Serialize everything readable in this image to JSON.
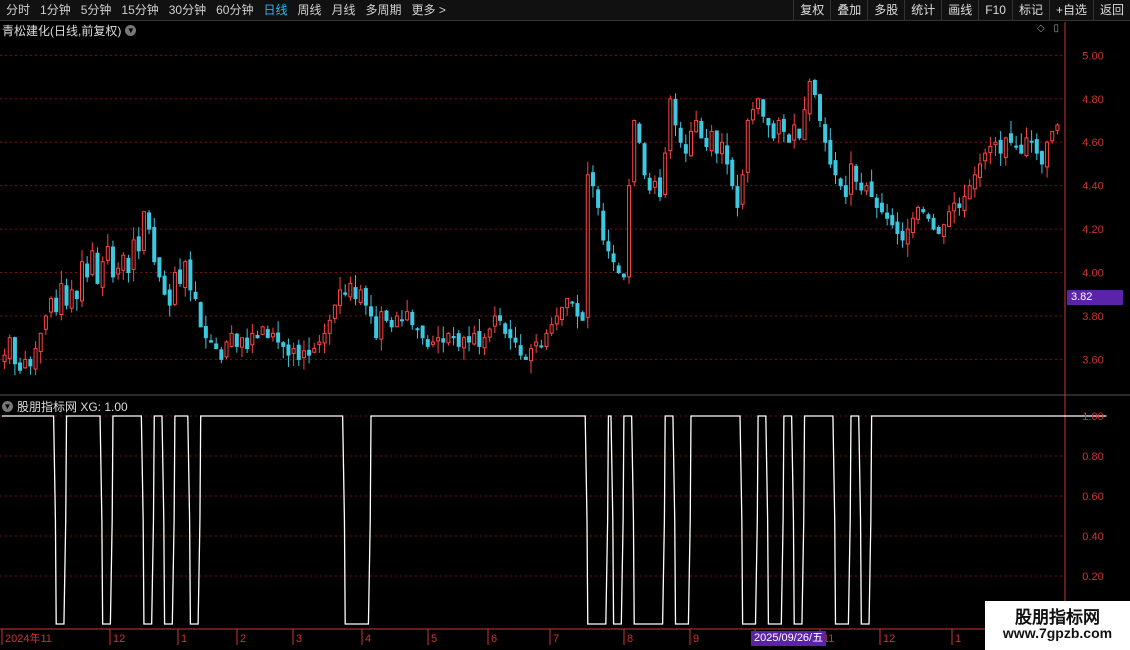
{
  "toolbar": {
    "periods": [
      "分时",
      "1分钟",
      "5分钟",
      "15分钟",
      "30分钟",
      "60分钟",
      "日线",
      "周线",
      "月线",
      "多周期",
      "更多 >"
    ],
    "active_period": "日线",
    "right_buttons": [
      "复权",
      "叠加",
      "多股",
      "统计",
      "画线",
      "F10",
      "标记",
      "+自选",
      "返回"
    ]
  },
  "main_chart": {
    "title": "青松建化(日线,前复权)",
    "current_price": "3.82",
    "y_ticks": [
      "5.00",
      "4.80",
      "4.60",
      "4.40",
      "4.20",
      "4.00",
      "3.80",
      "3.60"
    ]
  },
  "indicator": {
    "title": "股朋指标网 XG: 1.00",
    "y_ticks": [
      "1.00",
      "0.80",
      "0.60",
      "0.40",
      "0.20"
    ]
  },
  "x_axis": {
    "labels": [
      "2024年11",
      "12",
      "1",
      "2",
      "3",
      "4",
      "5",
      "6",
      "7",
      "8",
      "9",
      "10",
      "11",
      "12",
      "1"
    ],
    "cursor_date": "2025/09/26/五"
  },
  "watermark": {
    "title": "股朋指标网",
    "url": "www.7gpzb.com"
  },
  "colors": {
    "up": "#ff4444",
    "down": "#3cc8e0",
    "grid": "#7a1010",
    "axis": "#c33",
    "signal": "#ffffff"
  },
  "chart_data": {
    "type": "candlestick",
    "y_range": [
      3.45,
      5.08
    ],
    "note": "",
    "closes": [
      3.62,
      3.7,
      3.58,
      3.55,
      3.6,
      3.57,
      3.65,
      3.72,
      3.8,
      3.88,
      3.82,
      3.95,
      3.85,
      3.92,
      3.88,
      4.05,
      3.98,
      4.1,
      3.95,
      4.05,
      4.12,
      3.98,
      4.02,
      4.08,
      4.0,
      4.15,
      4.1,
      4.28,
      4.2,
      4.05,
      3.98,
      3.9,
      3.85,
      4.0,
      3.95,
      4.05,
      3.92,
      3.88,
      3.75,
      3.7,
      3.68,
      3.65,
      3.6,
      3.68,
      3.72,
      3.66,
      3.7,
      3.65,
      3.72,
      3.7,
      3.75,
      3.7,
      3.72,
      3.68,
      3.66,
      3.62,
      3.65,
      3.6,
      3.64,
      3.62,
      3.65,
      3.68,
      3.72,
      3.78,
      3.85,
      3.92,
      3.9,
      3.95,
      3.88,
      3.92,
      3.85,
      3.8,
      3.7,
      3.82,
      3.78,
      3.75,
      3.8,
      3.78,
      3.82,
      3.76,
      3.74,
      3.7,
      3.66,
      3.68,
      3.7,
      3.68,
      3.72,
      3.7,
      3.66,
      3.7,
      3.68,
      3.72,
      3.66,
      3.7,
      3.74,
      3.8,
      3.78,
      3.72,
      3.7,
      3.68,
      3.62,
      3.6,
      3.65,
      3.68,
      3.66,
      3.72,
      3.76,
      3.8,
      3.84,
      3.88,
      3.86,
      3.8,
      3.78,
      4.45,
      4.4,
      4.3,
      4.15,
      4.1,
      4.05,
      4.0,
      3.98,
      4.4,
      4.7,
      4.6,
      4.45,
      4.38,
      4.42,
      4.35,
      4.55,
      4.8,
      4.68,
      4.6,
      4.55,
      4.65,
      4.7,
      4.62,
      4.58,
      4.65,
      4.55,
      4.6,
      4.5,
      4.4,
      4.3,
      4.45,
      4.7,
      4.75,
      4.8,
      4.72,
      4.68,
      4.62,
      4.7,
      4.65,
      4.6,
      4.68,
      4.62,
      4.75,
      4.88,
      4.82,
      4.7,
      4.6,
      4.5,
      4.45,
      4.4,
      4.35,
      4.5,
      4.42,
      4.38,
      4.4,
      4.35,
      4.3,
      4.28,
      4.25,
      4.22,
      4.18,
      4.15,
      4.2,
      4.25,
      4.3,
      4.28,
      4.25,
      4.2,
      4.18,
      4.22,
      4.28,
      4.32,
      4.3,
      4.35,
      4.4,
      4.45,
      4.5,
      4.55,
      4.58,
      4.6,
      4.55,
      4.62,
      4.6,
      4.58,
      4.55,
      4.62,
      4.6,
      4.55,
      4.5,
      4.6,
      4.65,
      4.68
    ],
    "signal": [
      1,
      1,
      1,
      1,
      1,
      1,
      1,
      1,
      1,
      1,
      0,
      0,
      1,
      1,
      1,
      1,
      1,
      1,
      1,
      0,
      0,
      1,
      1,
      1,
      1,
      1,
      1,
      0,
      0,
      1,
      1,
      0,
      0,
      1,
      1,
      1,
      0,
      0,
      1,
      1,
      1,
      1,
      1,
      1,
      1,
      1,
      1,
      1,
      1,
      1,
      1,
      1,
      1,
      1,
      1,
      1,
      1,
      1,
      1,
      1,
      1,
      1,
      1,
      1,
      1,
      1,
      0,
      0,
      0,
      0,
      0,
      1,
      1,
      1,
      1,
      1,
      1,
      1,
      1,
      1,
      1,
      1,
      1,
      1,
      1,
      1,
      1,
      1,
      1,
      1,
      1,
      1,
      1,
      1,
      1,
      1,
      1,
      1,
      1,
      1,
      1,
      1,
      1,
      1,
      1,
      1,
      1,
      1,
      1,
      1,
      1,
      1,
      1,
      0,
      0,
      0,
      0,
      1,
      0,
      0,
      1,
      1,
      0,
      0,
      0,
      0,
      0,
      0,
      1,
      1,
      0,
      0,
      0,
      1,
      1,
      1,
      1,
      1,
      1,
      1,
      1,
      1,
      1,
      0,
      0,
      0,
      1,
      1,
      0,
      0,
      0,
      1,
      1,
      0,
      0,
      1,
      1,
      1,
      1,
      1,
      1,
      0,
      0,
      0,
      1,
      1,
      0,
      0,
      1,
      1,
      1,
      1,
      1,
      1,
      1,
      1,
      1,
      1,
      1,
      1,
      1,
      1,
      1,
      1,
      1,
      1,
      1,
      1,
      1,
      1,
      1,
      1,
      1,
      1,
      1,
      1,
      1,
      1,
      1,
      1,
      1,
      1,
      1,
      1,
      1,
      1,
      1,
      1,
      1,
      1,
      1,
      1,
      1,
      1
    ]
  }
}
